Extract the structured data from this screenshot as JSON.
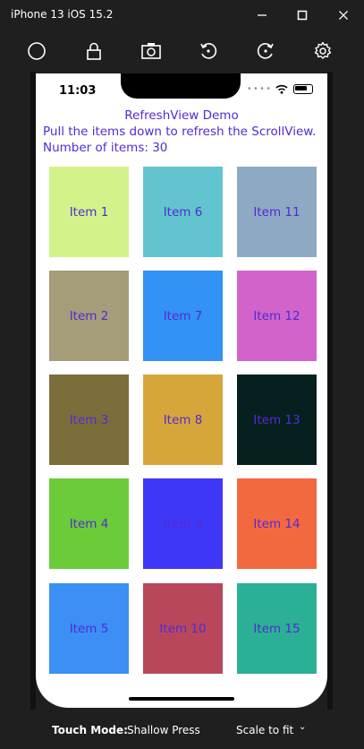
{
  "window": {
    "title": "iPhone 13 iOS 15.2"
  },
  "toolbar": {
    "buttons": [
      "home-icon",
      "lock-icon",
      "camera-icon",
      "rotate-left-icon",
      "rotate-right-icon",
      "gear-icon"
    ]
  },
  "status": {
    "time": "11:03"
  },
  "app": {
    "title": "RefreshView Demo",
    "instruction": "Pull the items down to refresh the ScrollView.",
    "count_text": "Number of items: 30"
  },
  "items": [
    {
      "label": "Item 1",
      "color": "#d4f28a"
    },
    {
      "label": "Item 2",
      "color": "#a59c7a"
    },
    {
      "label": "Item 3",
      "color": "#7c6e3a"
    },
    {
      "label": "Item 4",
      "color": "#6bcb39"
    },
    {
      "label": "Item 5",
      "color": "#3b8ff5"
    },
    {
      "label": "Item 6",
      "color": "#62c4cf"
    },
    {
      "label": "Item 7",
      "color": "#3392f5"
    },
    {
      "label": "Item 8",
      "color": "#d6a63b"
    },
    {
      "label": "Item 9",
      "color": "#3f37f7"
    },
    {
      "label": "Item 10",
      "color": "#b8475c"
    },
    {
      "label": "Item 11",
      "color": "#8ea9c3"
    },
    {
      "label": "Item 12",
      "color": "#d163cb"
    },
    {
      "label": "Item 13",
      "color": "#06201f"
    },
    {
      "label": "Item 14",
      "color": "#f3693f"
    },
    {
      "label": "Item 15",
      "color": "#2baf95"
    }
  ],
  "bottom": {
    "touch_mode_label": "Touch Mode:",
    "touch_mode_value": "Shallow Press",
    "scale": "Scale to fit"
  }
}
